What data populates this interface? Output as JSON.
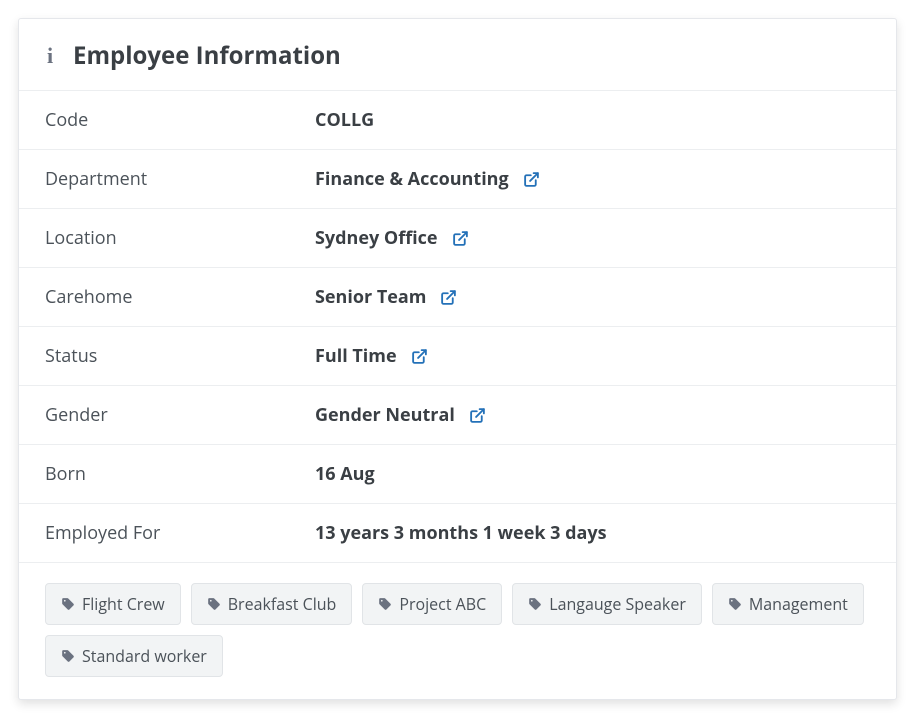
{
  "card": {
    "title": "Employee Information",
    "rows": [
      {
        "label": "Code",
        "value": "COLLG",
        "link": false
      },
      {
        "label": "Department",
        "value": "Finance & Accounting",
        "link": true
      },
      {
        "label": "Location",
        "value": "Sydney Office",
        "link": true
      },
      {
        "label": "Carehome",
        "value": "Senior Team",
        "link": true
      },
      {
        "label": "Status",
        "value": "Full Time",
        "link": true
      },
      {
        "label": "Gender",
        "value": "Gender Neutral",
        "link": true
      },
      {
        "label": "Born",
        "value": "16 Aug",
        "link": false
      },
      {
        "label": "Employed For",
        "value": "13 years 3 months 1 week 3 days",
        "link": false
      }
    ],
    "tags": [
      "Flight Crew",
      "Breakfast Club",
      "Project ABC",
      "Langauge Speaker",
      "Management",
      "Standard worker"
    ]
  }
}
